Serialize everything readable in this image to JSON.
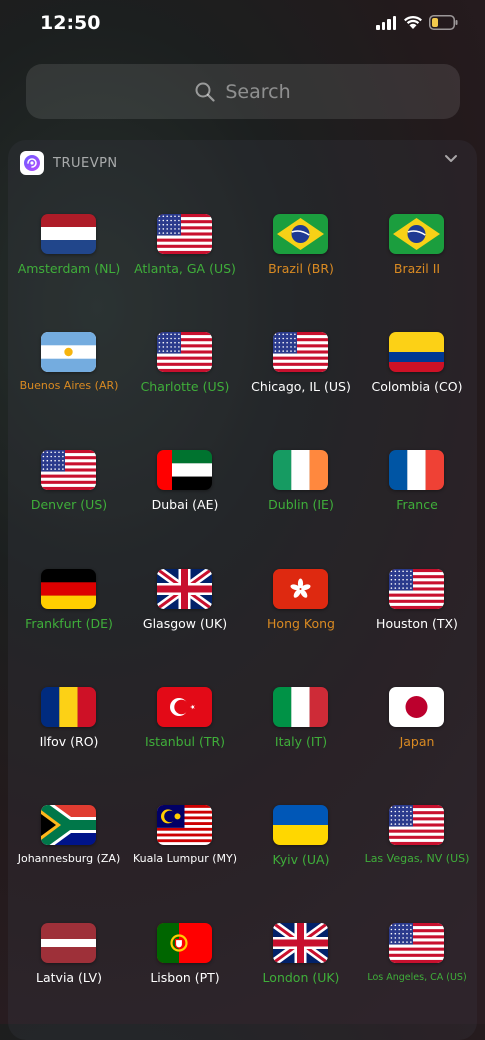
{
  "status_bar": {
    "time": "12:50"
  },
  "search": {
    "placeholder": "Search"
  },
  "app": {
    "name": "TRUEVPN"
  },
  "colors": {
    "online": "#3fae3a",
    "busy": "#d98a22",
    "normal": "#ffffff"
  },
  "servers": [
    {
      "label": "Amsterdam (NL)",
      "flag": "nl-flag-icon",
      "status": "green"
    },
    {
      "label": "Atlanta, GA (US)",
      "flag": "us-flag-icon",
      "status": "green"
    },
    {
      "label": "Brazil (BR)",
      "flag": "br-flag-icon",
      "status": "orange"
    },
    {
      "label": "Brazil II",
      "flag": "br-flag-icon",
      "status": "orange"
    },
    {
      "label": "Buenos Aires (AR)",
      "flag": "ar-flag-icon",
      "status": "orange"
    },
    {
      "label": "Charlotte (US)",
      "flag": "us-flag-icon",
      "status": "green"
    },
    {
      "label": "Chicago, IL (US)",
      "flag": "us-flag-icon",
      "status": "white"
    },
    {
      "label": "Colombia (CO)",
      "flag": "co-flag-icon",
      "status": "white"
    },
    {
      "label": "Denver (US)",
      "flag": "us-flag-icon",
      "status": "green"
    },
    {
      "label": "Dubai (AE)",
      "flag": "ae-flag-icon",
      "status": "white"
    },
    {
      "label": "Dublin (IE)",
      "flag": "ie-flag-icon",
      "status": "green"
    },
    {
      "label": "France",
      "flag": "fr-flag-icon",
      "status": "green"
    },
    {
      "label": "Frankfurt (DE)",
      "flag": "de-flag-icon",
      "status": "green"
    },
    {
      "label": "Glasgow (UK)",
      "flag": "uk-flag-icon",
      "status": "white"
    },
    {
      "label": "Hong Kong",
      "flag": "hk-flag-icon",
      "status": "orange"
    },
    {
      "label": "Houston (TX)",
      "flag": "us-flag-icon",
      "status": "white"
    },
    {
      "label": "Ilfov (RO)",
      "flag": "ro-flag-icon",
      "status": "white"
    },
    {
      "label": "Istanbul (TR)",
      "flag": "tr-flag-icon",
      "status": "green"
    },
    {
      "label": "Italy (IT)",
      "flag": "it-flag-icon",
      "status": "green"
    },
    {
      "label": "Japan",
      "flag": "jp-flag-icon",
      "status": "orange"
    },
    {
      "label": "Johannesburg (ZA)",
      "flag": "za-flag-icon",
      "status": "white"
    },
    {
      "label": "Kuala Lumpur (MY)",
      "flag": "my-flag-icon",
      "status": "white"
    },
    {
      "label": "Kyiv (UA)",
      "flag": "ua-flag-icon",
      "status": "green"
    },
    {
      "label": "Las Vegas, NV (US)",
      "flag": "us-flag-icon",
      "status": "green"
    },
    {
      "label": "Latvia (LV)",
      "flag": "lv-flag-icon",
      "status": "white"
    },
    {
      "label": "Lisbon (PT)",
      "flag": "pt-flag-icon",
      "status": "white"
    },
    {
      "label": "London (UK)",
      "flag": "uk-flag-icon",
      "status": "green"
    },
    {
      "label": "Los Angeles, CA (US)",
      "flag": "us-flag-icon",
      "status": "green"
    }
  ]
}
